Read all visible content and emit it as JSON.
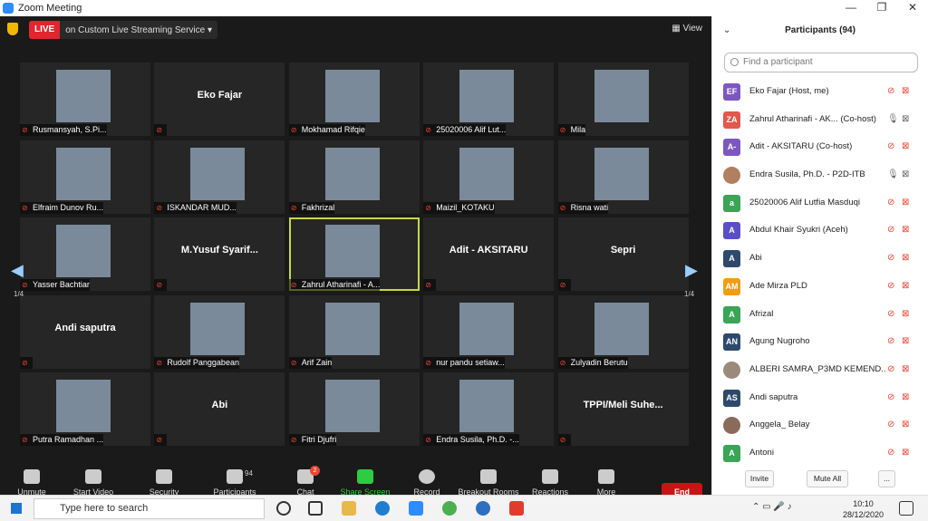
{
  "window": {
    "title": "Zoom Meeting",
    "controls": [
      "—",
      "❐",
      "✕"
    ]
  },
  "topbar": {
    "live_badge": "LIVE",
    "live_text": "on Custom Live Streaming Service ▾",
    "view_label": "View"
  },
  "grid": {
    "pager_left": "1/4",
    "pager_right": "1/4",
    "tiles": [
      {
        "name": "Rusmansyah, S.Pi...",
        "mode": "photo"
      },
      {
        "name": "Eko Fajar",
        "mode": "name"
      },
      {
        "name": "Mokhamad Rifqie",
        "mode": "photo"
      },
      {
        "name": "25020006 Alif Lut...",
        "mode": "photo"
      },
      {
        "name": "Mila",
        "mode": "photo"
      },
      {
        "name": "Elfraim Dunov Ru...",
        "mode": "photo"
      },
      {
        "name": "ISKANDAR MUD...",
        "mode": "photo"
      },
      {
        "name": "Fakhrizal",
        "mode": "photo"
      },
      {
        "name": "Maizil_KOTAKU",
        "mode": "photo"
      },
      {
        "name": "Risna wati",
        "mode": "photo"
      },
      {
        "name": "Yasser Bachtiar",
        "mode": "photo"
      },
      {
        "name": "M.Yusuf Syarif...",
        "mode": "name"
      },
      {
        "name": "Zahrul Atharinafi - A...",
        "mode": "photo",
        "active": true
      },
      {
        "name": "Adit - AKSITARU",
        "mode": "name"
      },
      {
        "name": "Sepri",
        "mode": "name"
      },
      {
        "name": "Andi saputra",
        "mode": "name"
      },
      {
        "name": "Rudolf Panggabean",
        "mode": "photo"
      },
      {
        "name": "Arif Zain",
        "mode": "photo"
      },
      {
        "name": "nur pandu setiaw...",
        "mode": "photo"
      },
      {
        "name": "Zulyadin Berutu",
        "mode": "photo"
      },
      {
        "name": "Putra Ramadhan ...",
        "mode": "photo"
      },
      {
        "name": "Abi",
        "mode": "name"
      },
      {
        "name": "Fitri Djufri",
        "mode": "photo"
      },
      {
        "name": "Endra Susila, Ph.D. -...",
        "mode": "photo"
      },
      {
        "name": "TPPI/Meli Suhe...",
        "mode": "name"
      }
    ]
  },
  "toolbar": {
    "items": [
      {
        "label": "Unmute",
        "icon": "mic-muted-icon"
      },
      {
        "label": "Start Video",
        "icon": "video-off-icon"
      },
      {
        "label": "Security",
        "icon": "shield-icon"
      },
      {
        "label": "Participants",
        "icon": "participants-icon",
        "count": "94"
      },
      {
        "label": "Chat",
        "icon": "chat-icon",
        "badge": "2"
      },
      {
        "label": "Share Screen",
        "icon": "share-screen-icon"
      },
      {
        "label": "Record",
        "icon": "record-icon"
      },
      {
        "label": "Breakout Rooms",
        "icon": "breakout-rooms-icon"
      },
      {
        "label": "Reactions",
        "icon": "reactions-icon"
      },
      {
        "label": "More",
        "icon": "more-icon"
      }
    ],
    "end_label": "End"
  },
  "panel": {
    "title": "Participants (94)",
    "search_placeholder": "Find a participant",
    "participants": [
      {
        "initials": "EF",
        "color": "#7d57c1",
        "name": "Eko Fajar (Host, me)"
      },
      {
        "initials": "ZA",
        "color": "#e2584c",
        "name": "Zahrul Atharinafi - AK...  (Co-host)",
        "mic": "on"
      },
      {
        "initials": "A-",
        "color": "#7d57c1",
        "name": "Adit - AKSITARU (Co-host)"
      },
      {
        "initials": "",
        "color": "#b08060",
        "name": "Endra Susila, Ph.D. - P2D-ITB",
        "mic": "on"
      },
      {
        "initials": "a",
        "color": "#3aa556",
        "name": "25020006 Alif Lutfia Masduqi"
      },
      {
        "initials": "A",
        "color": "#5a4fc8",
        "name": "Abdul Khair Syukri (Aceh)"
      },
      {
        "initials": "A",
        "color": "#2e4a6b",
        "name": "Abi"
      },
      {
        "initials": "AM",
        "color": "#f39c12",
        "name": "Ade Mirza PLD"
      },
      {
        "initials": "A",
        "color": "#3aa556",
        "name": "Afrizal"
      },
      {
        "initials": "AN",
        "color": "#2e4a6b",
        "name": "Agung Nugroho"
      },
      {
        "initials": "",
        "color": "#9a8a7a",
        "name": "ALBERI SAMRA_P3MD KEMEND..."
      },
      {
        "initials": "AS",
        "color": "#2e4a6b",
        "name": "Andi saputra"
      },
      {
        "initials": "",
        "color": "#8a6a5a",
        "name": "Anggela_ Belay"
      },
      {
        "initials": "A",
        "color": "#3aa556",
        "name": "Antoni"
      }
    ],
    "footer": {
      "invite": "Invite",
      "mute_all": "Mute All",
      "more": "..."
    }
  },
  "taskbar": {
    "search_placeholder": "Type here to search",
    "time": "10:10",
    "date": "28/12/2020"
  }
}
